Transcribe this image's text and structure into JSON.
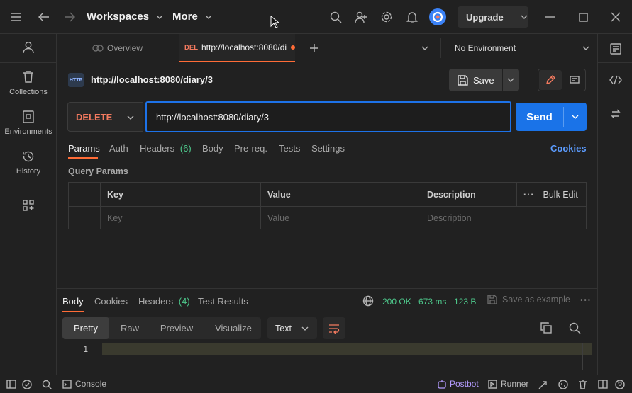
{
  "topbar": {
    "workspaces_label": "Workspaces",
    "more_label": "More",
    "upgrade_label": "Upgrade",
    "icons": [
      "menu-icon",
      "back-arrow-icon",
      "forward-arrow-icon",
      "search-icon",
      "invite-user-icon",
      "settings-gear-icon",
      "notification-bell-icon",
      "avatar",
      "minimize-icon",
      "maximize-icon",
      "close-icon"
    ]
  },
  "sidebar": {
    "items": [
      {
        "label": "",
        "icon": "user-icon"
      },
      {
        "label": "Collections",
        "icon": "trash-collections-icon"
      },
      {
        "label": "Environments",
        "icon": "environments-icon"
      },
      {
        "label": "History",
        "icon": "history-icon"
      },
      {
        "label": "",
        "icon": "apps-grid-icon"
      }
    ]
  },
  "tabs": {
    "overview_label": "Overview",
    "active_method": "DEL",
    "active_label": "http://localhost:8080/di",
    "environment_label": "No Environment"
  },
  "request": {
    "title": "http://localhost:8080/diary/3",
    "save_label": "Save",
    "method": "DELETE",
    "url": "http://localhost:8080/diary/3",
    "send_label": "Send",
    "subtabs": {
      "params": "Params",
      "auth": "Auth",
      "headers": "Headers",
      "headers_count": "(6)",
      "body": "Body",
      "prereq": "Pre-req.",
      "tests": "Tests",
      "settings": "Settings",
      "cookies": "Cookies"
    },
    "query_params_label": "Query Params",
    "table": {
      "headers": {
        "key": "Key",
        "value": "Value",
        "description": "Description",
        "bulk_edit": "Bulk Edit"
      },
      "placeholders": {
        "key": "Key",
        "value": "Value",
        "description": "Description"
      }
    }
  },
  "response": {
    "tabs": {
      "body": "Body",
      "cookies": "Cookies",
      "headers": "Headers",
      "headers_count": "(4)",
      "test_results": "Test Results"
    },
    "status": "200 OK",
    "time": "673 ms",
    "size": "123 B",
    "save_example_label": "Save as example",
    "views": {
      "pretty": "Pretty",
      "raw": "Raw",
      "preview": "Preview",
      "visualize": "Visualize"
    },
    "format": "Text",
    "line_number": "1"
  },
  "statusbar": {
    "console_label": "Console",
    "postbot_label": "Postbot",
    "runner_label": "Runner"
  },
  "colors": {
    "accent_blue": "#1a73e8",
    "method_delete": "#f47a5f",
    "status_green": "#4ec98c",
    "postbot_purple": "#b49cff",
    "tab_active_orange": "#ff6c37"
  }
}
